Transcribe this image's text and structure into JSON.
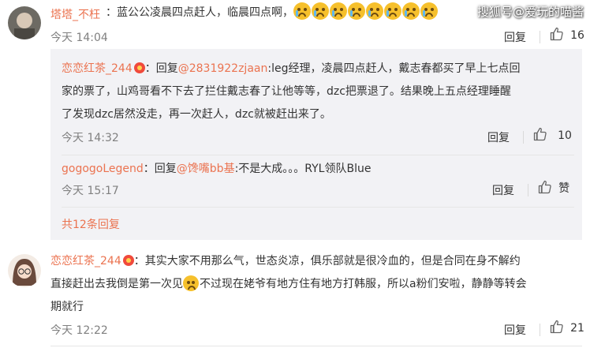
{
  "watermark": "搜狐号@爱玩的喵酱",
  "comments": [
    {
      "user": "塔塔_不枉",
      "text": "：蓝公公凌晨四点赶人，临晨四点啊，",
      "time": "今天 14:04",
      "reply_label": "回复",
      "like_count": "16"
    },
    {
      "user": "恋恋红茶_244",
      "line1": "：其实大家不用那么气，世态炎凉，俱乐部就是很冷血的，但是合同在身不解约",
      "line2a": "直接赶出去我倒是第一次见",
      "line2b": "不过现在姥爷有地方住有地方打韩服，所以a粉们安啦，静静等转会",
      "line3": "期就行",
      "time": "今天 12:22",
      "reply_label": "回复",
      "like_count": "21"
    }
  ],
  "replies": [
    {
      "user": "恋恋红茶_244",
      "prefix": "：回复",
      "mention": "@2831922zjaan",
      "line1": ":leg经理，凌晨四点赶人，戴志春都买了早上七点回",
      "line2": "家的票了，山鸡哥看不下去了拦住戴志春了让他等等，dzc把票退了。结果晚上五点经理睡醒",
      "line3": "了发现dzc居然没走，再一次赶人，dzc就被赶出来了。",
      "time": "今天 14:32",
      "reply_label": "回复",
      "like_count": "10"
    },
    {
      "user": "gogogoLegend",
      "prefix": "：回复",
      "mention": "@馋嘴bb基",
      "text": ":不是大成。。。RYL领队Blue",
      "time": "今天 15:17",
      "reply_label": "回复",
      "like_label": "赞"
    }
  ],
  "more_replies": "共12条回复",
  "colors": {
    "accent": "#eb7350",
    "reply_bg": "#f2f2f5",
    "meta": "#808080"
  },
  "icons": [
    "thumbs-up-icon",
    "crying-emoji",
    "shy-emoji",
    "vip-badge-icon"
  ]
}
